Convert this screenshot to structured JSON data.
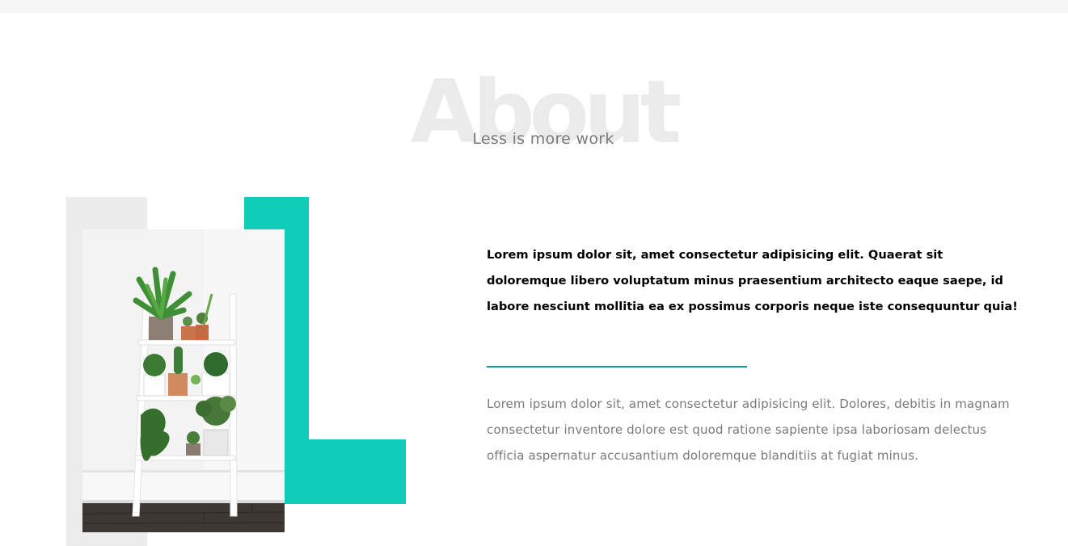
{
  "about": {
    "bg_title": "About",
    "subtitle": "Less is more work",
    "lead_text": "Lorem ipsum dolor sit, amet consectetur adipisicing elit. Quaerat sit doloremque libero voluptatum minus praesentium architecto eaque saepe, id labore nesciunt mollitia ea ex possimus corporis neque iste consequuntur quia!",
    "body_text": "Lorem ipsum dolor sit, amet consectetur adipisicing elit. Dolores, debitis in magnam consectetur inventore dolore est quod ratione sapiente ipsa laboriosam delectus officia aspernatur accusantium doloremque blanditiis at fugiat minus."
  },
  "colors": {
    "accent": "#10cdba",
    "divider": "#14958a",
    "muted_block": "#ececec",
    "bg_title": "#ebebeb",
    "muted_text": "#7a7a7a"
  },
  "image": {
    "subject": "plants-on-white-ladder-shelf-photo"
  }
}
